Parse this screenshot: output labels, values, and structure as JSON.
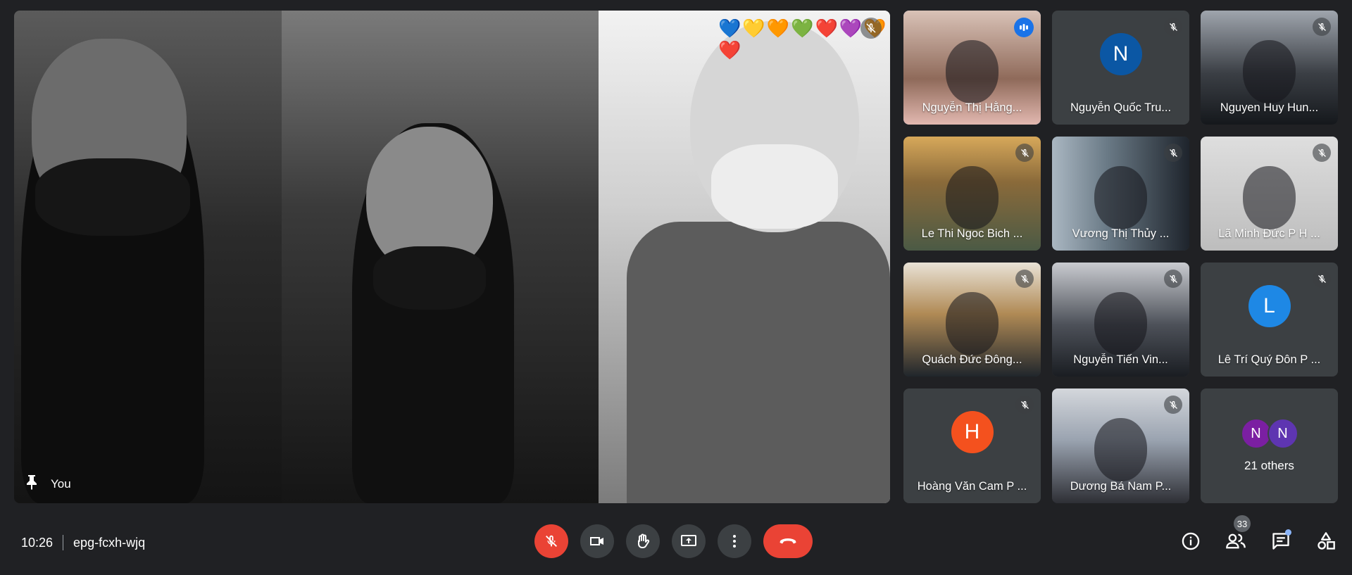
{
  "main_video": {
    "label": "You",
    "muted": true,
    "pin_icon": "pin-icon",
    "sticker": "💙💛🧡💚❤️💜🧡❤️"
  },
  "tiles": [
    {
      "name": "Nguyễn Thị Hằng...",
      "type": "video",
      "speaking": true
    },
    {
      "name": "Nguyễn Quốc Tru...",
      "type": "avatar",
      "initial": "N",
      "color": "#0b57a4"
    },
    {
      "name": "Nguyen Huy Hun...",
      "type": "video"
    },
    {
      "name": "Le Thi Ngoc Bich ...",
      "type": "video"
    },
    {
      "name": "Vương Thị Thủy ...",
      "type": "video"
    },
    {
      "name": "Lã Minh Đức P H ...",
      "type": "video"
    },
    {
      "name": "Quách Đức Đông...",
      "type": "video"
    },
    {
      "name": "Nguyễn Tiến Vin...",
      "type": "video"
    },
    {
      "name": "Lê Trí Quý Đôn P ...",
      "type": "avatar",
      "initial": "L",
      "color": "#1e88e5"
    },
    {
      "name": "Hoàng Văn Cam P ...",
      "type": "avatar",
      "initial": "H",
      "color": "#f4511e"
    },
    {
      "name": "Dương Bá Nam P...",
      "type": "video"
    }
  ],
  "others": {
    "avatars": [
      "N",
      "N"
    ],
    "label": "21 others"
  },
  "bottom": {
    "time": "10:26",
    "meeting_code": "epg-fcxh-wjq",
    "participants_count": "33"
  },
  "colors": {
    "accent": "#8ab4f8",
    "danger": "#ea4335",
    "tile_bg": "#3c4043",
    "bg": "#202124"
  }
}
